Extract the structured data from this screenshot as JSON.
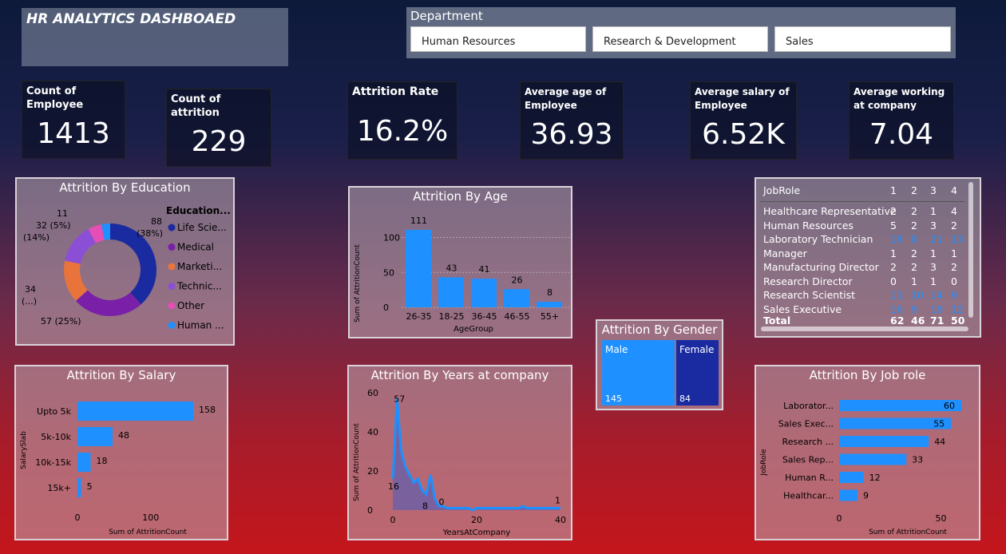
{
  "header": {
    "title": "HR ANALYTICS DASHBOAED"
  },
  "department": {
    "label": "Department",
    "options": [
      "Human Resources",
      "Research & Development",
      "Sales"
    ]
  },
  "kpis": [
    {
      "title": "Count of Employee",
      "value": "1413"
    },
    {
      "title": "Count of attrition",
      "value": "229"
    },
    {
      "title": "Attrition Rate",
      "value": "16.2%"
    },
    {
      "title": "Average age of Employee",
      "value": "36.93"
    },
    {
      "title": "Average salary of Employee",
      "value": "6.52K"
    },
    {
      "title": "Average working at company",
      "value": "7.04"
    }
  ],
  "colors": {
    "primary": "#1e90ff",
    "navy": "#1a2aa0",
    "purple": "#7a1fa8",
    "orange": "#e8743b",
    "violet": "#8b4fd6",
    "pink": "#e44fb5"
  },
  "education": {
    "title": "Attrition By Education",
    "legend_title": "Education...",
    "legend": [
      "Life Scie...",
      "Medical",
      "Marketi...",
      "Technic...",
      "Other",
      "Human ..."
    ],
    "labels": {
      "life": "88",
      "life_pct": "(38%)",
      "medical": "57 (25%)",
      "marketing": "34",
      "marketing_pct": "(...)",
      "technical": "32 (5%)",
      "technical_pct": "(14%)",
      "other": "11"
    }
  },
  "age": {
    "title": "Attrition By Age",
    "ylabel": "Sum of AttritionCount",
    "xlabel": "AgeGroup",
    "yticks": [
      "0",
      "50",
      "100"
    ]
  },
  "gender": {
    "title": "Attrition By Gender",
    "male": "Male",
    "female": "Female",
    "male_v": "145",
    "female_v": "84"
  },
  "matrix": {
    "header": [
      "JobRole",
      "1",
      "2",
      "3",
      "4"
    ],
    "rows": [
      [
        "Healthcare Representative",
        "2",
        "2",
        "1",
        "4"
      ],
      [
        "Human Resources",
        "5",
        "2",
        "3",
        "2"
      ],
      [
        "Laboratory Technician",
        "18",
        "8",
        "21",
        "13"
      ],
      [
        "Manager",
        "1",
        "2",
        "1",
        "1"
      ],
      [
        "Manufacturing Director",
        "2",
        "2",
        "3",
        "2"
      ],
      [
        "Research Director",
        "0",
        "1",
        "1",
        "0"
      ],
      [
        "Research Scientist",
        "11",
        "10",
        "14",
        "9"
      ],
      [
        "Sales Executive",
        "16",
        "9",
        "18",
        "12"
      ]
    ],
    "total": [
      "Total",
      "62",
      "46",
      "71",
      "50"
    ]
  },
  "salary": {
    "title": "Attrition By Salary",
    "ylabel": "SalarySlab",
    "xlabel": "Sum of AttritionCount",
    "xticks": [
      "0",
      "100"
    ]
  },
  "years": {
    "title": "Attrition By Years at company",
    "ylabel": "Sum of AttritionCount",
    "xlabel": "YearsAtCompany",
    "yticks": [
      "0",
      "20",
      "40",
      "60"
    ],
    "xticks": [
      "0",
      "20",
      "40"
    ],
    "labels": [
      "57",
      "16",
      "8",
      "0",
      "1"
    ]
  },
  "jobrole": {
    "title": "Attrition By Job role",
    "ylabel": "JobRole",
    "xlabel": "Sum of AttritionCount",
    "xticks": [
      "0",
      "50"
    ]
  },
  "chart_data": [
    {
      "type": "pie",
      "title": "Attrition By Education",
      "categories": [
        "Life Sciences",
        "Medical",
        "Marketing",
        "Technical",
        "Other",
        "Human Resources"
      ],
      "values": [
        88,
        57,
        34,
        32,
        11,
        7
      ]
    },
    {
      "type": "bar",
      "title": "Attrition By Age",
      "xlabel": "AgeGroup",
      "ylabel": "Sum of AttritionCount",
      "categories": [
        "26-35",
        "18-25",
        "36-45",
        "46-55",
        "55+"
      ],
      "values": [
        111,
        43,
        41,
        26,
        8
      ],
      "ylim": [
        0,
        120
      ]
    },
    {
      "type": "bar",
      "title": "Attrition By Salary",
      "xlabel": "Sum of AttritionCount",
      "ylabel": "SalarySlab",
      "categories": [
        "Upto 5k",
        "5k-10k",
        "10k-15k",
        "15k+"
      ],
      "values": [
        158,
        48,
        18,
        5
      ],
      "xlim": [
        0,
        170
      ]
    },
    {
      "type": "line",
      "title": "Attrition By Years at company",
      "xlabel": "YearsAtCompany",
      "ylabel": "Sum of AttritionCount",
      "x": [
        0,
        1,
        2,
        3,
        4,
        5,
        6,
        7,
        8,
        9,
        10,
        11,
        12,
        13,
        14,
        15,
        16,
        17,
        18,
        19,
        20,
        21,
        22,
        23,
        24,
        25,
        26,
        27,
        28,
        29,
        30,
        31,
        32,
        33,
        34,
        35,
        36,
        37,
        38,
        39,
        40
      ],
      "values": [
        16,
        57,
        30,
        22,
        18,
        14,
        16,
        10,
        8,
        18,
        6,
        2,
        2,
        1,
        1,
        1,
        1,
        1,
        1,
        0,
        1,
        1,
        1,
        1,
        1,
        1,
        1,
        1,
        1,
        1,
        1,
        2,
        1,
        1,
        1,
        1,
        1,
        1,
        1,
        1,
        1
      ],
      "ylim": [
        0,
        60
      ],
      "xlim": [
        0,
        40
      ]
    },
    {
      "type": "bar",
      "title": "Attrition By Job role",
      "xlabel": "Sum of AttritionCount",
      "ylabel": "JobRole",
      "categories": [
        "Laborator...",
        "Sales Exec...",
        "Research ...",
        "Sales Rep...",
        "Human R...",
        "Healthcar..."
      ],
      "values": [
        60,
        55,
        44,
        33,
        12,
        9
      ],
      "xlim": [
        0,
        65
      ]
    },
    {
      "type": "bar",
      "title": "Attrition By Gender",
      "categories": [
        "Male",
        "Female"
      ],
      "values": [
        145,
        84
      ]
    }
  ]
}
